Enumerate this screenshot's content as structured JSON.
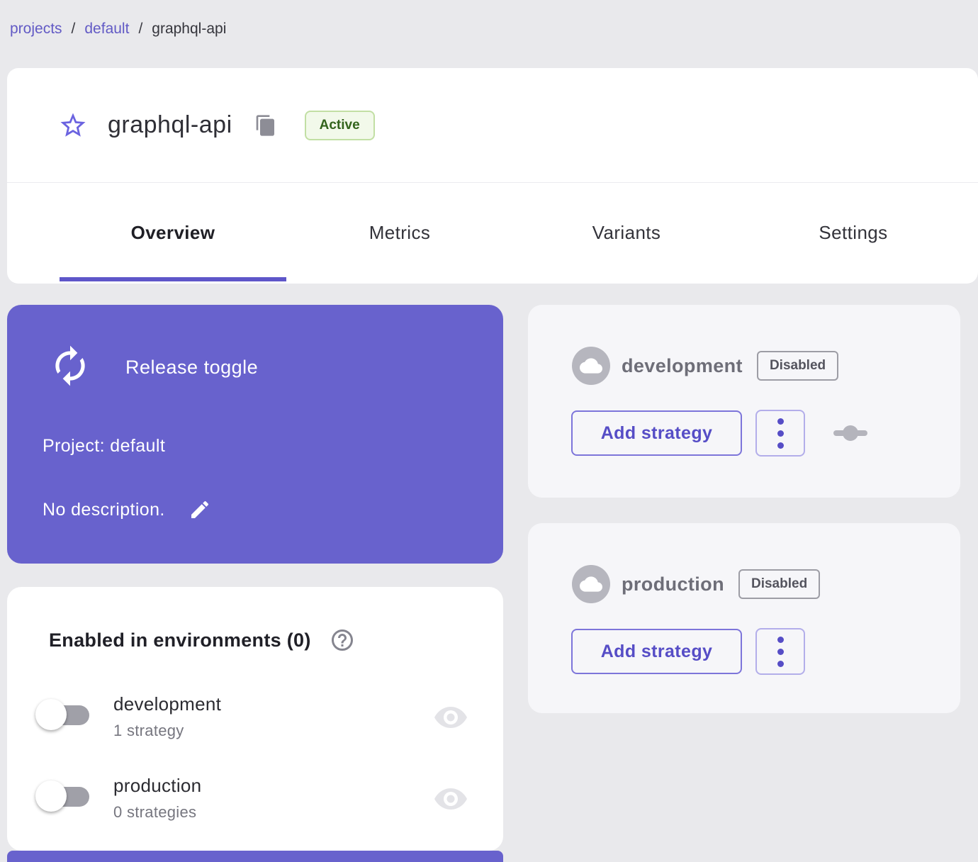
{
  "breadcrumb": {
    "separator": "/",
    "items": [
      {
        "label": "projects"
      },
      {
        "label": "default"
      },
      {
        "label": "graphql-api"
      }
    ]
  },
  "header": {
    "title": "graphql-api",
    "status": "Active",
    "icons": {
      "favorite": "star-outline-icon",
      "copy": "copy-icon"
    }
  },
  "tabs": [
    {
      "label": "Overview",
      "active": true
    },
    {
      "label": "Metrics",
      "active": false
    },
    {
      "label": "Variants",
      "active": false
    },
    {
      "label": "Settings",
      "active": false
    }
  ],
  "toggle_card": {
    "type_label": "Release toggle",
    "project_label": "Project: default",
    "description": "No description.",
    "icons": {
      "type": "release-cycle-icon",
      "edit": "pencil-icon"
    }
  },
  "environments": [
    {
      "name": "development",
      "status": "Disabled",
      "add_button": "Add strategy",
      "icons": [
        "cloud-icon",
        "kebab-menu-icon",
        "commit-icon"
      ]
    },
    {
      "name": "production",
      "status": "Disabled",
      "add_button": "Add strategy",
      "icons": [
        "cloud-icon",
        "kebab-menu-icon"
      ]
    }
  ],
  "enabled_card": {
    "title": "Enabled in environments (0)",
    "help_icon": "help-circle-icon",
    "rows": [
      {
        "name": "development",
        "strategies": "1 strategy",
        "enabled": false,
        "icon": "eye-icon"
      },
      {
        "name": "production",
        "strategies": "0 strategies",
        "enabled": false,
        "icon": "eye-icon"
      }
    ]
  },
  "colors": {
    "primary_purple": "#6862cd",
    "link_purple": "#625ac5",
    "button_purple": "#564dc6",
    "page_background": "#e9e9ec",
    "card_background": "#ffffff",
    "env_card_background": "#f6f6f9",
    "active_badge_text": "#33641c",
    "active_badge_bg": "#f2f9ea",
    "active_badge_border": "#c2dfa4",
    "disabled_badge_text": "#54545e",
    "muted_gray": "#6e6e78"
  }
}
